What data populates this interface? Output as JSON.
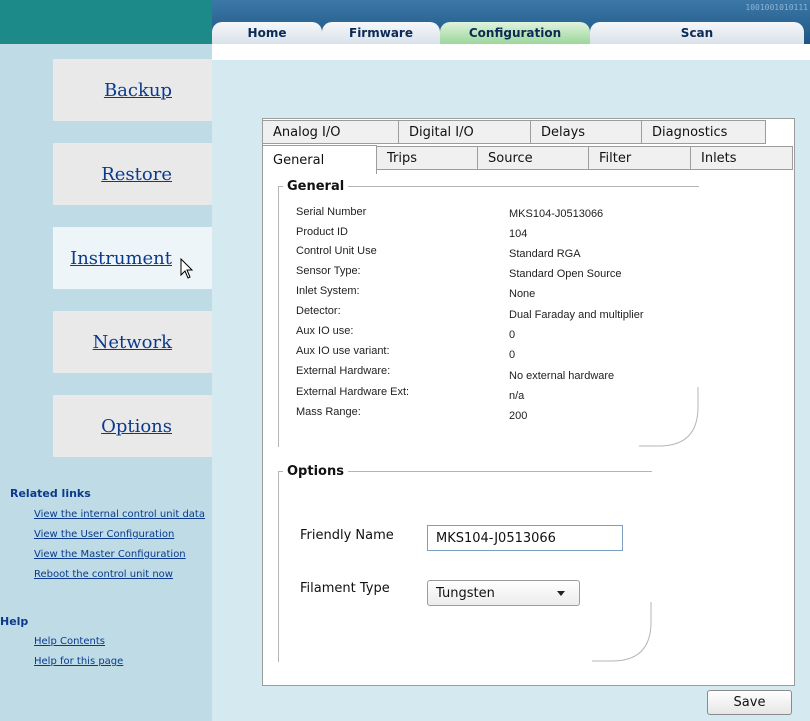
{
  "topnav": {
    "binary_decoration": "1001001010111",
    "tabs": [
      {
        "label": "Home"
      },
      {
        "label": "Firmware"
      },
      {
        "label": "Configuration",
        "active": true
      },
      {
        "label": "Scan"
      }
    ]
  },
  "sidebar": {
    "buttons": [
      {
        "label": "Backup"
      },
      {
        "label": "Restore"
      },
      {
        "label": "Instrument",
        "active": true
      },
      {
        "label": "Network"
      },
      {
        "label": "Options"
      }
    ],
    "related_links_title": "Related links",
    "related_links": [
      {
        "label": "View the internal control unit data"
      },
      {
        "label": "View the User Configuration"
      },
      {
        "label": "View the Master Configuration"
      },
      {
        "label": "Reboot the control unit now"
      }
    ],
    "help_title": "Help",
    "help_links": [
      {
        "label": "Help Contents"
      },
      {
        "label": "Help for this page"
      }
    ]
  },
  "tabs_row1": [
    {
      "label": "Analog I/O"
    },
    {
      "label": "Digital I/O"
    },
    {
      "label": "Delays"
    },
    {
      "label": "Diagnostics"
    }
  ],
  "tabs_row2": [
    {
      "label": "General",
      "active": true
    },
    {
      "label": "Trips"
    },
    {
      "label": "Source"
    },
    {
      "label": "Filter"
    },
    {
      "label": "Inlets"
    }
  ],
  "general": {
    "title": "General",
    "fields": [
      {
        "label": "Serial Number",
        "value": "MKS104-J0513066"
      },
      {
        "label": "Product ID",
        "value": "104"
      },
      {
        "label": "Control Unit Use",
        "value": "Standard RGA"
      },
      {
        "label": "Sensor Type:",
        "value": "Standard Open Source"
      },
      {
        "label": "Inlet System:",
        "value": "None"
      },
      {
        "label": "Detector:",
        "value": "Dual Faraday and multiplier"
      },
      {
        "label": "Aux IO use:",
        "value": "0"
      },
      {
        "label": "Aux IO use variant:",
        "value": "0"
      },
      {
        "label": "External Hardware:",
        "value": "No external hardware"
      },
      {
        "label": "External Hardware Ext:",
        "value": "n/a"
      },
      {
        "label": "Mass Range:",
        "value": "200"
      }
    ]
  },
  "options": {
    "title": "Options",
    "friendly_name_label": "Friendly Name",
    "friendly_name_value": "MKS104-J0513066",
    "filament_type_label": "Filament Type",
    "filament_type_value": "Tungsten"
  },
  "save_label": "Save",
  "colors": {
    "link": "#0b3a8c",
    "sidebar_bg": "#bfdce6",
    "main_bg": "#d5e9f0",
    "active_nav": "#9bd79a"
  }
}
